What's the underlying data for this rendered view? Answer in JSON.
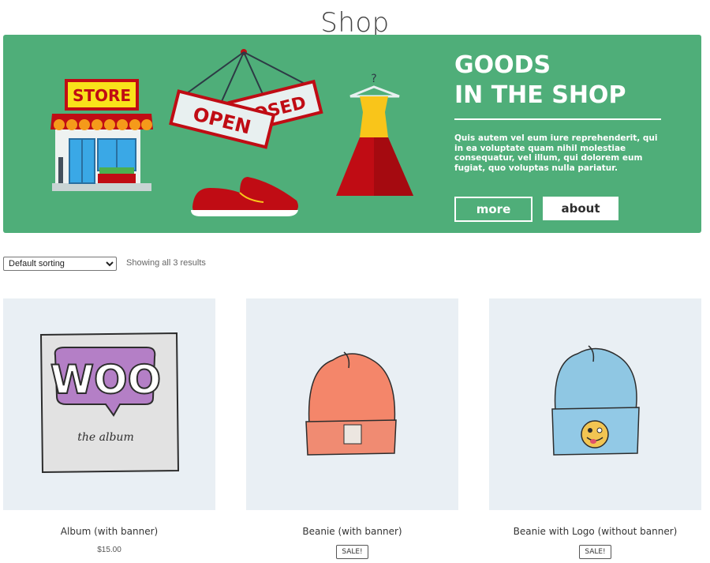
{
  "page": {
    "title": "Shop"
  },
  "banner": {
    "heading_line1": "GOODS",
    "heading_line2": "IN THE SHOP",
    "text": "Quis autem vel eum iure reprehenderit, qui in ea voluptate quam nihil molestiae consequatur, vel illum, qui dolorem eum fugiat, quo voluptas nulla pariatur.",
    "more_label": "more",
    "about_label": "about",
    "art": {
      "store_sign": "STORE",
      "open_sign": "OPEN",
      "closed_sign": "OSED",
      "hanger_mark": "?"
    },
    "colors": {
      "background": "#4fae79",
      "accent_red": "#c00c14",
      "accent_yellow": "#f9c51a"
    }
  },
  "toolbar": {
    "sort_selected": "Default sorting",
    "result_count": "Showing all 3 results"
  },
  "products": [
    {
      "name": "Album (with banner)",
      "price": "$15.00",
      "art_text": "WOO",
      "art_subtext": "the album"
    },
    {
      "name": "Beanie (with banner)",
      "badge": "SALE!"
    },
    {
      "name": "Beanie with Logo (without banner)",
      "badge": "SALE!"
    }
  ]
}
